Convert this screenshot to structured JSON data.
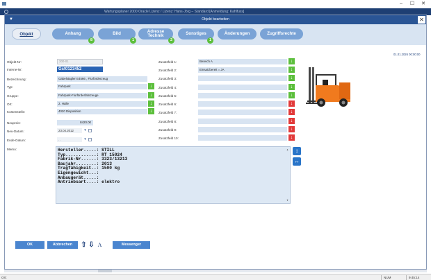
{
  "window": {
    "title": "Wartungsplaner 2000 Oracle Lizenz / Lizenz: Hans-Jörg – Standard [Anmeldung: Kahlfuss]",
    "controls": {
      "minimize": "–",
      "maximize": "☐",
      "close": "✕"
    }
  },
  "dialog": {
    "title": "Objekt bearbeiten",
    "menu_glyph": "▼",
    "close_glyph": "✕",
    "timestamp": "01.01.2026 00:00:00"
  },
  "tabs": [
    {
      "label": "Objekt",
      "badge": ""
    },
    {
      "label": "Anhang",
      "badge": "8"
    },
    {
      "label": "Bild",
      "badge": "1"
    },
    {
      "label_line1": "Adresse",
      "label_line2": "Technik",
      "badge": "2"
    },
    {
      "label": "Sonstiges",
      "badge": "1"
    },
    {
      "label": "Änderungen",
      "badge": ""
    },
    {
      "label": "Zugriffsrechte",
      "badge": ""
    }
  ],
  "form": {
    "objekt_nr": {
      "label": "Objekt-Nr:",
      "value": "200-01"
    },
    "interne_nr": {
      "label": "Interne-Nr:",
      "value": "Gst0123452"
    },
    "bezeichnung": {
      "label": "Bezeichnung:",
      "value": "Gabelstapler E4566 , Flurförderzeug"
    },
    "typ": {
      "label": "Typ:",
      "value": "Fahrpark"
    },
    "gruppe": {
      "label": "Gruppe:",
      "value": "Fahrpark-Flurförderfahrzeuge"
    },
    "ort": {
      "label": "Ort:",
      "value": "2. Halle"
    },
    "kostenstelle": {
      "label": "Kostenstelle:",
      "value": "4020 Disposition"
    },
    "neupreis": {
      "label": "Neupreis:",
      "value": "8420.00"
    },
    "neu_datum": {
      "label": "Neu-Datum:",
      "value": "23.04.2012"
    },
    "ende_datum": {
      "label": "Ende-Datum:",
      "value": ". ."
    },
    "memo": {
      "label": "Memo:"
    }
  },
  "zusatzfelder": [
    {
      "label": "Zusatzfeld 1:",
      "value": "Bereich A",
      "arrow": "green"
    },
    {
      "label": "Zusatzfeld 2:",
      "value": "Einsatzbereit = JA",
      "arrow": "green"
    },
    {
      "label": "Zusatzfeld 3:",
      "value": "",
      "arrow": "green"
    },
    {
      "label": "Zusatzfeld 4:",
      "value": "",
      "arrow": "green"
    },
    {
      "label": "Zusatzfeld 5:",
      "value": "",
      "arrow": "green"
    },
    {
      "label": "Zusatzfeld 6:",
      "value": "",
      "arrow": "red"
    },
    {
      "label": "Zusatzfeld 7:",
      "value": "",
      "arrow": "red"
    },
    {
      "label": "Zusatzfeld 8:",
      "value": "",
      "arrow": "red"
    },
    {
      "label": "Zusatzfeld 9:",
      "value": "",
      "arrow": "red"
    },
    {
      "label": "Zusatzfeld 10:",
      "value": "",
      "arrow": "red"
    }
  ],
  "memo_text": "Hersteller.....: STILL\nTyp............: RT 15024\nFabrik-Nr......: 3323/13213\nBaujahr........: 2013\nTragfähigkeit..: 1500 kg\nEigengewicht...:\nAnbaugerät.....:\nAntriebsart....: elektro",
  "buttons": {
    "ok": "OK",
    "abbrechen": "Abbrechen",
    "messenger": "Messenger",
    "upload_glyph": "⇧",
    "download_glyph": "⇩",
    "font_glyph": "A"
  },
  "statusbar": {
    "left": "Ort:",
    "num": "NUM",
    "time": "9:45:14"
  },
  "colors": {
    "title_bar": "#2a5595",
    "tab_bar": "#d8e4f2",
    "tab": "#7aa3d6",
    "badge": "#5cbf3c",
    "arrow_green": "#5cbf3c",
    "arrow_red": "#e23a3a",
    "field": "#d8e4f2",
    "button": "#4a85cf"
  }
}
